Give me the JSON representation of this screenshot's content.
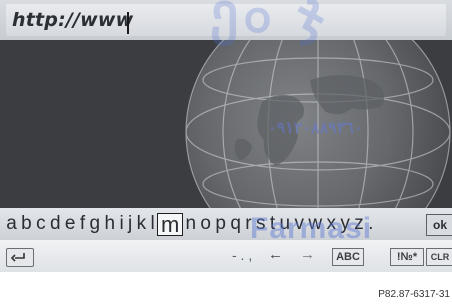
{
  "url_bar": {
    "text": "http://www"
  },
  "keyboard": {
    "characters_before": [
      "a",
      "b",
      "c",
      "d",
      "e",
      "f",
      "g",
      "h",
      "i",
      "j",
      "k",
      "l"
    ],
    "selected_character": "m",
    "characters_after": [
      "n",
      "o",
      "p",
      "q",
      "r",
      "s",
      "t",
      "u",
      "v",
      "w",
      "x",
      "y",
      "z",
      "."
    ],
    "ok_label": "ok"
  },
  "controls": {
    "symbols": "- . ,",
    "abc_label": "ABC",
    "numeric_label": "!№*",
    "clear_label": "CLR"
  },
  "watermark": {
    "text": "Farmasi",
    "phone": "٠٩١٢٠٨٨٩٣٦٠"
  },
  "footer": {
    "image_code": "P82.87-6317-31"
  },
  "icons": {
    "back": "back-arrow-icon",
    "left_arrow": "left-arrow-icon",
    "right_arrow": "right-arrow-icon",
    "globe": "globe-image"
  }
}
